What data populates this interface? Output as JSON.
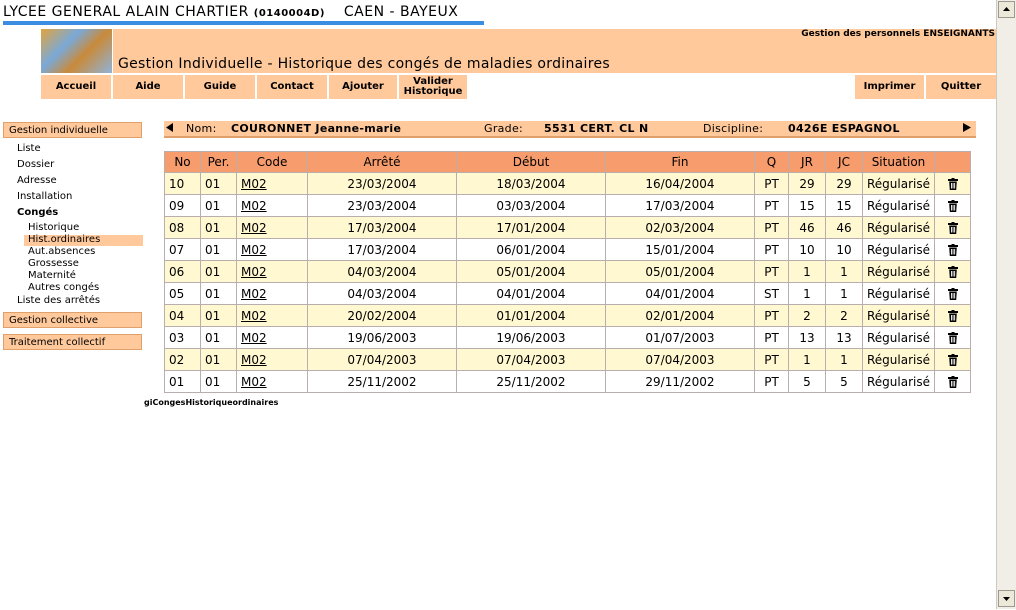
{
  "header": {
    "school_name": "LYCEE GENERAL ALAIN CHARTIER",
    "school_code": "(0140004D)",
    "city": "CAEN - BAYEUX"
  },
  "banner": {
    "subtitle": "Gestion des personnels ENSEIGNANTS",
    "title": "Gestion Individuelle - Historique des congés de maladies ordinaires"
  },
  "toolbar": {
    "accueil": "Accueil",
    "aide": "Aide",
    "guide": "Guide",
    "contact": "Contact",
    "ajouter": "Ajouter",
    "valider_line1": "Valider",
    "valider_line2": "Historique",
    "imprimer": "Imprimer",
    "quitter": "Quitter"
  },
  "sidebar": {
    "gestion_individuelle": "Gestion individuelle",
    "liste": "Liste",
    "dossier": "Dossier",
    "adresse": "Adresse",
    "installation": "Installation",
    "conges": "Congés",
    "historique": "Historique",
    "hist_ordinaires": "Hist.ordinaires",
    "aut_absences": "Aut.absences",
    "grossesse": "Grossesse",
    "maternite": "Maternité",
    "autres_conges": "Autres congés",
    "liste_arretes": "Liste des arrêtés",
    "gestion_collective": "Gestion collective",
    "traitement_collectif": "Traitement collectif"
  },
  "person": {
    "nom_label": "Nom:",
    "nom": "COURONNET Jeanne-marie",
    "grade_label": "Grade:",
    "grade": "5531 CERT. CL N",
    "discipline_label": "Discipline:",
    "discipline": "0426E ESPAGNOL"
  },
  "table": {
    "headers": [
      "No",
      "Per.",
      "Code",
      "Arrêté",
      "Début",
      "Fin",
      "Q",
      "JR",
      "JC",
      "Situation",
      ""
    ],
    "rows": [
      [
        "10",
        "01",
        "M02",
        "23/03/2004",
        "18/03/2004",
        "16/04/2004",
        "PT",
        "29",
        "29",
        "Régularisé"
      ],
      [
        "09",
        "01",
        "M02",
        "23/03/2004",
        "03/03/2004",
        "17/03/2004",
        "PT",
        "15",
        "15",
        "Régularisé"
      ],
      [
        "08",
        "01",
        "M02",
        "17/03/2004",
        "17/01/2004",
        "02/03/2004",
        "PT",
        "46",
        "46",
        "Régularisé"
      ],
      [
        "07",
        "01",
        "M02",
        "17/03/2004",
        "06/01/2004",
        "15/01/2004",
        "PT",
        "10",
        "10",
        "Régularisé"
      ],
      [
        "06",
        "01",
        "M02",
        "04/03/2004",
        "05/01/2004",
        "05/01/2004",
        "PT",
        "1",
        "1",
        "Régularisé"
      ],
      [
        "05",
        "01",
        "M02",
        "04/03/2004",
        "04/01/2004",
        "04/01/2004",
        "ST",
        "1",
        "1",
        "Régularisé"
      ],
      [
        "04",
        "01",
        "M02",
        "20/02/2004",
        "01/01/2004",
        "02/01/2004",
        "PT",
        "2",
        "2",
        "Régularisé"
      ],
      [
        "03",
        "01",
        "M02",
        "19/06/2003",
        "19/06/2003",
        "01/07/2003",
        "PT",
        "13",
        "13",
        "Régularisé"
      ],
      [
        "02",
        "01",
        "M02",
        "07/04/2003",
        "07/04/2003",
        "07/04/2003",
        "PT",
        "1",
        "1",
        "Régularisé"
      ],
      [
        "01",
        "01",
        "M02",
        "25/11/2002",
        "25/11/2002",
        "29/11/2002",
        "PT",
        "5",
        "5",
        "Régularisé"
      ]
    ]
  },
  "footer": {
    "page_id": "giCongesHistoriqueordinaires"
  },
  "icons": {
    "delete": "trash-icon",
    "prev": "arrow-left-icon",
    "next": "arrow-right-icon"
  },
  "colors": {
    "accent": "#ffc99c",
    "table_header": "#f79c6c",
    "row_highlight": "#fff8d0",
    "underline": "#3a8de0"
  }
}
